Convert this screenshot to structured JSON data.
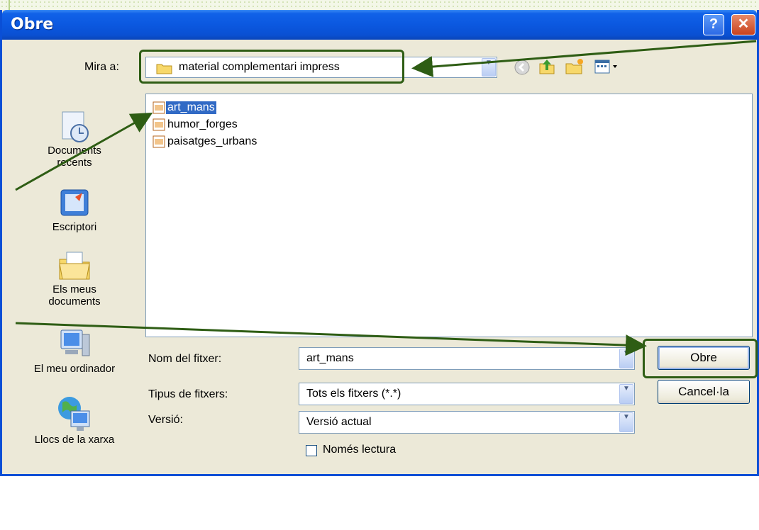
{
  "dialog": {
    "title": "Obre",
    "help_label": "?",
    "close_label": "✕"
  },
  "lookin": {
    "label": "Mira a:",
    "value": "material complementari impress"
  },
  "places": [
    {
      "label_line1": "Documents",
      "label_line2": "recents",
      "icon": "recent-documents-icon"
    },
    {
      "label_line1": "Escriptori",
      "label_line2": "",
      "icon": "desktop-icon"
    },
    {
      "label_line1": "Els meus",
      "label_line2": "documents",
      "icon": "my-documents-icon"
    },
    {
      "label_line1": "El meu ordinador",
      "label_line2": "",
      "icon": "my-computer-icon"
    },
    {
      "label_line1": "Llocs de la xarxa",
      "label_line2": "",
      "icon": "network-places-icon"
    }
  ],
  "files": [
    {
      "name": "art_mans",
      "selected": true
    },
    {
      "name": "humor_forges",
      "selected": false
    },
    {
      "name": "paisatges_urbans",
      "selected": false
    }
  ],
  "form": {
    "filename_label": "Nom del fitxer:",
    "filename_value": "art_mans",
    "filetype_label": "Tipus de fitxers:",
    "filetype_value": "Tots els fitxers (*.*)",
    "version_label": "Versió:",
    "version_value": "Versió actual",
    "readonly_label": "Només lectura"
  },
  "buttons": {
    "open": "Obre",
    "cancel": "Cancel·la"
  },
  "colors": {
    "titlebar": "#0a58e0",
    "selection": "#316ac5",
    "annotation": "#2e5d14"
  }
}
